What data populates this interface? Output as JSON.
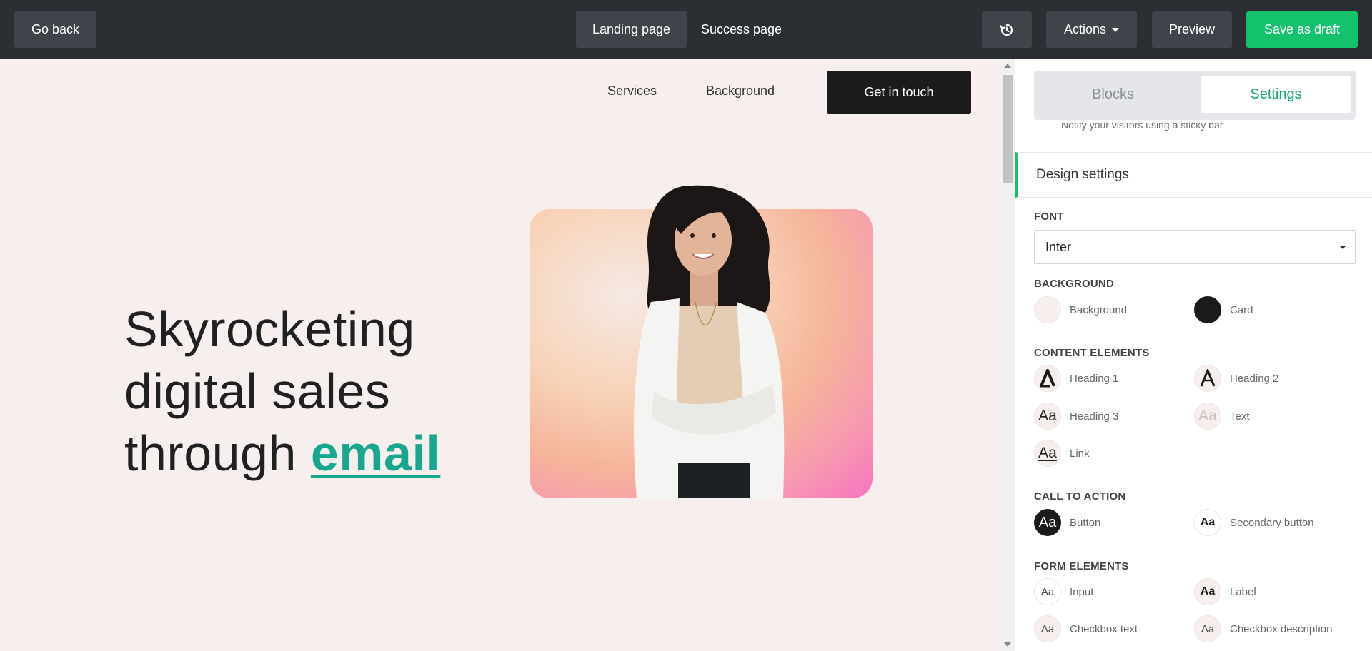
{
  "topbar": {
    "go_back": "Go back",
    "tabs": [
      "Landing page",
      "Success page"
    ],
    "actions": "Actions",
    "preview": "Preview",
    "save": "Save as draft"
  },
  "canvas": {
    "nav": {
      "services": "Services",
      "background": "Background",
      "cta": "Get in touch"
    },
    "hero": {
      "line1": "Skyrocketing",
      "line2": "digital sales",
      "line3": "through",
      "accent": "email"
    }
  },
  "panel": {
    "tabs": {
      "blocks": "Blocks",
      "settings": "Settings"
    },
    "peek_text": "Notify your visitors using a sticky bar",
    "design_settings": "Design settings",
    "font": {
      "title": "FONT",
      "value": "Inter"
    },
    "background": {
      "title": "BACKGROUND",
      "items": [
        {
          "label": "Background",
          "color": "#f7efed"
        },
        {
          "label": "Card",
          "color": "#1b1b1b"
        }
      ]
    },
    "content_elements": {
      "title": "CONTENT ELEMENTS",
      "items": [
        {
          "label": "Heading 1",
          "glyph": "A"
        },
        {
          "label": "Heading 2",
          "glyph": "A"
        },
        {
          "label": "Heading 3",
          "glyph": "Aa"
        },
        {
          "label": "Text",
          "glyph": "Aa"
        },
        {
          "label": "Link",
          "glyph": "Aa"
        }
      ]
    },
    "call_to_action": {
      "title": "CALL TO ACTION",
      "items": [
        {
          "label": "Button",
          "glyph": "Aa"
        },
        {
          "label": "Secondary button",
          "glyph": "Aa"
        }
      ]
    },
    "form_elements": {
      "title": "FORM ELEMENTS",
      "items": [
        {
          "label": "Input",
          "glyph": "Aa"
        },
        {
          "label": "Label",
          "glyph": "Aa"
        },
        {
          "label": "Checkbox text",
          "glyph": "Aa"
        },
        {
          "label": "Checkbox description",
          "glyph": "Aa"
        }
      ]
    }
  },
  "colors": {
    "accent_green": "#13c26b",
    "hero_accent": "#17a78e",
    "topbar": "#2b2e33",
    "canvas_bg": "#f7efed"
  }
}
